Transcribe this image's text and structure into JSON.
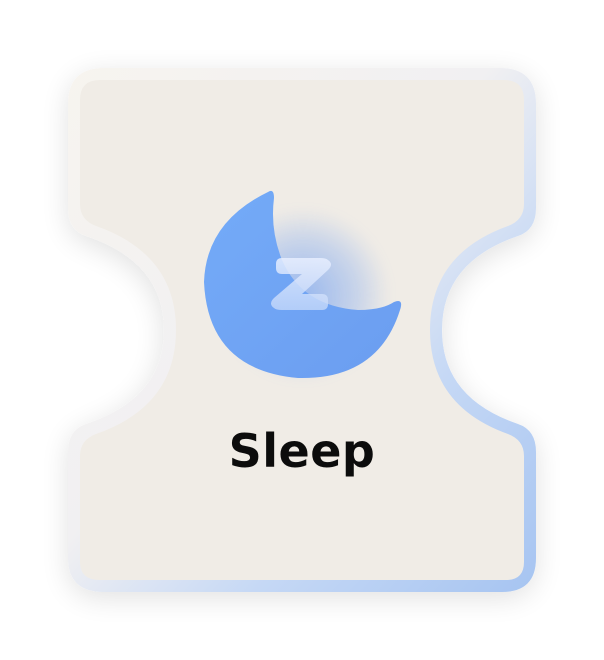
{
  "tile": {
    "label": "Sleep",
    "icon": "moon-sleep-icon",
    "colors": {
      "fill": "#f0ece6",
      "border_light": "#f6f2ec",
      "border_accent": "#a9c7f3",
      "moon_top": "#6ea6f6",
      "moon_bottom": "#6f9fef",
      "text": "#0c0c0c"
    }
  }
}
